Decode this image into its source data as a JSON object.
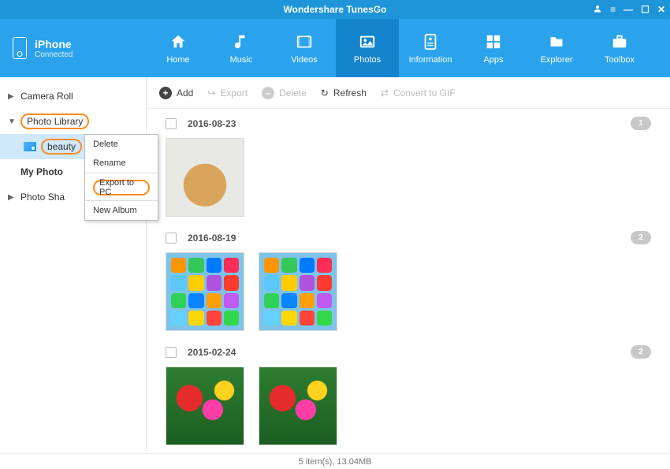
{
  "titlebar": {
    "title": "Wondershare TunesGo"
  },
  "device": {
    "name": "iPhone",
    "status": "Connected"
  },
  "nav": [
    {
      "label": "Home"
    },
    {
      "label": "Music"
    },
    {
      "label": "Videos"
    },
    {
      "label": "Photos"
    },
    {
      "label": "Information"
    },
    {
      "label": "Apps"
    },
    {
      "label": "Explorer"
    },
    {
      "label": "Toolbox"
    }
  ],
  "sidebar": {
    "camera_roll": "Camera Roll",
    "photo_library": "Photo Library",
    "album_beauty": "beauty",
    "my_photo": "My Photo",
    "photo_sha": "Photo Sha"
  },
  "context_menu": {
    "delete": "Delete",
    "rename": "Rename",
    "export_pc": "Export to PC",
    "new_album": "New Album"
  },
  "toolbar": {
    "add": "Add",
    "export": "Export",
    "delete": "Delete",
    "refresh": "Refresh",
    "convert": "Convert to GIF"
  },
  "groups": [
    {
      "date": "2016-08-23",
      "count": "1"
    },
    {
      "date": "2016-08-19",
      "count": "2"
    },
    {
      "date": "2015-02-24",
      "count": "2"
    }
  ],
  "statusbar": {
    "text": "5 item(s), 13.04MB"
  },
  "app_colors": [
    "#ff9500",
    "#34c759",
    "#007aff",
    "#ff2d55",
    "#5ac8fa",
    "#ffcc00",
    "#af52de",
    "#ff3b30",
    "#30d158",
    "#0a84ff",
    "#ff9f0a",
    "#bf5af2",
    "#64d2ff",
    "#ffd60a",
    "#ff453a",
    "#32d74b"
  ]
}
